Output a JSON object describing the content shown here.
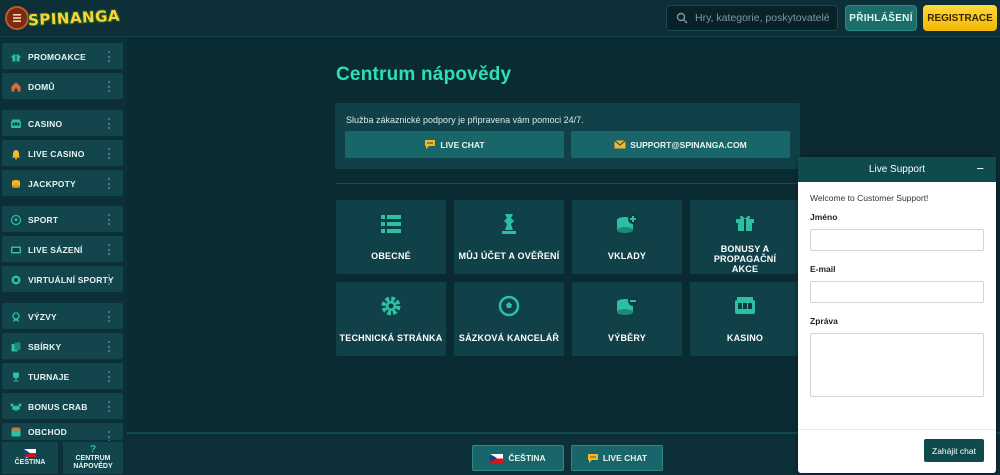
{
  "header": {
    "logo_text": "SPINANGA",
    "search_placeholder": "Hry, kategorie, poskytovatelé",
    "login_label": "PŘIHLÁŠENÍ",
    "register_label": "REGISTRACE"
  },
  "sidebar": {
    "items": [
      {
        "label": "PROMOAKCE",
        "icon": "gift-icon"
      },
      {
        "label": "DOMŮ",
        "icon": "home-icon"
      },
      {
        "label": "CASINO",
        "icon": "slot-machine-icon"
      },
      {
        "label": "LIVE CASINO",
        "icon": "bell-icon"
      },
      {
        "label": "JACKPOTY",
        "icon": "coins-icon"
      },
      {
        "label": "SPORT",
        "icon": "soccer-ball-icon"
      },
      {
        "label": "LIVE SÁZENÍ",
        "icon": "live-tv-icon"
      },
      {
        "label": "VIRTUÁLNÍ SPORTY",
        "icon": "virtual-ball-icon"
      },
      {
        "label": "VÝZVY",
        "icon": "medal-icon"
      },
      {
        "label": "SBÍRKY",
        "icon": "cards-icon"
      },
      {
        "label": "TURNAJE",
        "icon": "trophy-icon"
      },
      {
        "label": "BONUS CRAB",
        "icon": "crab-icon"
      },
      {
        "label": "OBCHOD",
        "icon": "shop-icon"
      }
    ],
    "bottom": {
      "language_label": "ČEŠTINA",
      "help_label_1": "CENTRUM",
      "help_label_2": "NÁPOVĚDY"
    }
  },
  "main": {
    "title": "Centrum nápovědy",
    "support_text": "Služba zákaznické podpory je připravena vám pomoci 24/7.",
    "live_chat_label": "LIVE CHAT",
    "email_label": "SUPPORT@SPINANGA.COM",
    "categories": [
      {
        "label": "OBECNÉ",
        "icon": "list-icon"
      },
      {
        "label": "MŮJ ÚČET A OVĚŘENÍ",
        "icon": "chess-piece-icon"
      },
      {
        "label": "VKLADY",
        "icon": "coins-plus-icon"
      },
      {
        "label": "BONUSY A PROPAGAČNÍ AKCE",
        "icon": "gift-icon"
      },
      {
        "label": "TECHNICKÁ STRÁNKA",
        "icon": "gear-icon"
      },
      {
        "label": "SÁZKOVÁ KANCELÁŘ",
        "icon": "soccer-ball-icon"
      },
      {
        "label": "VÝBĚRY",
        "icon": "coins-minus-icon"
      },
      {
        "label": "KASINO",
        "icon": "slot-machine-icon"
      }
    ]
  },
  "bottombar": {
    "language_label": "ČEŠTINA",
    "live_chat_label": "LIVE CHAT"
  },
  "live_support": {
    "title": "Live Support",
    "minimize": "−",
    "welcome": "Welcome to Customer Support!",
    "name_label": "Jméno",
    "email_label": "E-mail",
    "message_label": "Zpráva",
    "name_value": "",
    "email_value": "",
    "message_value": "",
    "start_label": "Zahájit chat"
  },
  "colors": {
    "background": "#0b2b33",
    "panel": "#104048",
    "accent": "#2ee0b0",
    "register": "#ffd93a"
  }
}
